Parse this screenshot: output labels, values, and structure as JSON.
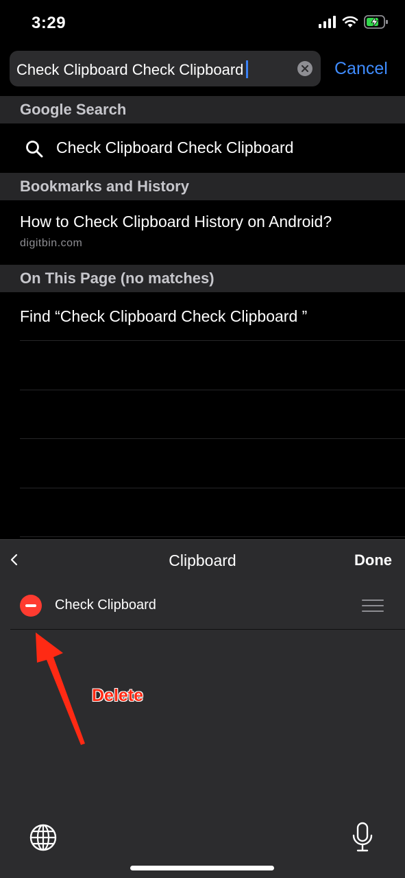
{
  "status_bar": {
    "time": "3:29"
  },
  "search": {
    "query": "Check Clipboard Check Clipboard",
    "cancel_label": "Cancel"
  },
  "sections": {
    "google_header": "Google Search",
    "google_suggestion": "Check Clipboard Check Clipboard",
    "bookmarks_header": "Bookmarks and History",
    "history_item": {
      "title": "How to Check Clipboard History on Android?",
      "url": "digitbin.com"
    },
    "on_page_header": "On This Page (no matches)",
    "find_label": "Find “Check Clipboard Check Clipboard ”"
  },
  "clipboard_bar": {
    "title": "Clipboard",
    "done_label": "Done"
  },
  "clipboard_items": [
    {
      "label": "Check Clipboard"
    }
  ],
  "annotation": {
    "label": "Delete",
    "color": "#ff2a14"
  },
  "icons": {
    "search": "search-icon",
    "clear": "clear-icon",
    "back": "chevron-left-icon",
    "delete": "minus-circle-icon",
    "drag": "drag-handle-icon",
    "globe": "globe-icon",
    "mic": "microphone-icon"
  },
  "colors": {
    "accent": "#3f8cff",
    "delete": "#ff3b30"
  }
}
